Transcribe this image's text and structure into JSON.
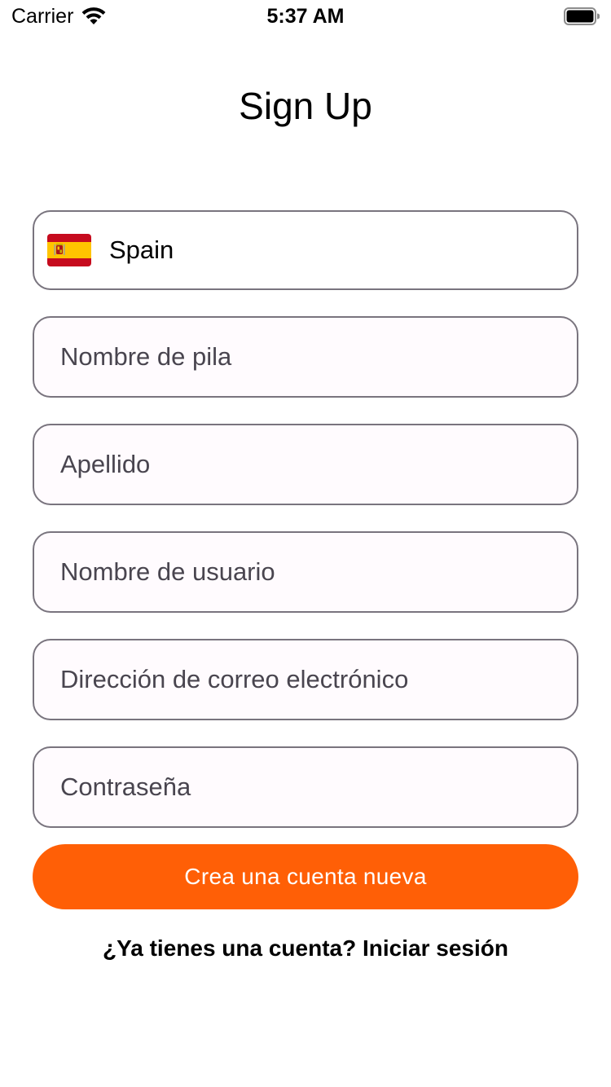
{
  "status_bar": {
    "carrier": "Carrier",
    "time": "5:37 AM",
    "wifi_icon": "wifi-icon",
    "battery_icon": "battery-icon"
  },
  "title": "Sign Up",
  "country": {
    "flag_icon": "spain-flag-icon",
    "name": "Spain"
  },
  "fields": {
    "first_name": {
      "placeholder": "Nombre de pila",
      "value": ""
    },
    "last_name": {
      "placeholder": "Apellido",
      "value": ""
    },
    "username": {
      "placeholder": "Nombre de usuario",
      "value": ""
    },
    "email": {
      "placeholder": "Dirección de correo electrónico",
      "value": ""
    },
    "password": {
      "placeholder": "Contraseña",
      "value": ""
    }
  },
  "create_button_label": "Crea una cuenta nueva",
  "login_link": "¿Ya tienes una cuenta? Iniciar sesión",
  "colors": {
    "accent": "#ff5f06",
    "field_border": "#79747e",
    "field_background": "#fffbfe",
    "placeholder_text": "#49454f"
  }
}
